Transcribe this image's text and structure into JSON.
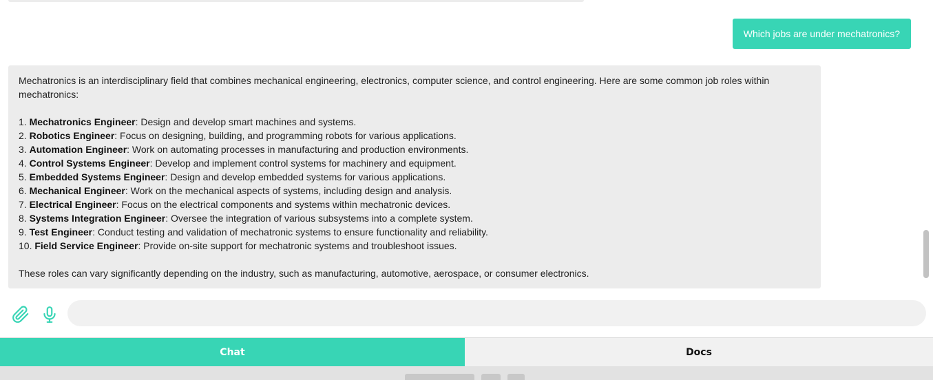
{
  "colors": {
    "accent": "#38d5b5",
    "bubble_bg": "#ececec",
    "input_bg": "#f1f1f1"
  },
  "messages": {
    "user": "Which jobs are under mechatronics?",
    "bot": {
      "intro": "Mechatronics is an interdisciplinary field that combines mechanical engineering, electronics, computer science, and control engineering. Here are some common job roles within mechatronics:",
      "items": [
        {
          "num": "1.",
          "title": "Mechatronics Engineer",
          "desc": ": Design and develop smart machines and systems."
        },
        {
          "num": "2.",
          "title": "Robotics Engineer",
          "desc": ": Focus on designing, building, and programming robots for various applications."
        },
        {
          "num": "3.",
          "title": "Automation Engineer",
          "desc": ": Work on automating processes in manufacturing and production environments."
        },
        {
          "num": "4.",
          "title": "Control Systems Engineer",
          "desc": ": Develop and implement control systems for machinery and equipment."
        },
        {
          "num": "5.",
          "title": "Embedded Systems Engineer",
          "desc": ": Design and develop embedded systems for various applications."
        },
        {
          "num": "6.",
          "title": "Mechanical Engineer",
          "desc": ": Work on the mechanical aspects of systems, including design and analysis."
        },
        {
          "num": "7.",
          "title": "Electrical Engineer",
          "desc": ": Focus on the electrical components and systems within mechatronic devices."
        },
        {
          "num": "8.",
          "title": "Systems Integration Engineer",
          "desc": ": Oversee the integration of various subsystems into a complete system."
        },
        {
          "num": "9.",
          "title": "Test Engineer",
          "desc": ": Conduct testing and validation of mechatronic systems to ensure functionality and reliability."
        },
        {
          "num": "10.",
          "title": "Field Service Engineer",
          "desc": ": Provide on-site support for mechatronic systems and troubleshoot issues."
        }
      ],
      "outro": "These roles can vary significantly depending on the industry, such as manufacturing, automotive, aerospace, or consumer electronics."
    }
  },
  "input": {
    "value": "",
    "attach_icon": "paperclip-icon",
    "mic_icon": "microphone-icon"
  },
  "tabs": {
    "chat": "Chat",
    "docs": "Docs",
    "active": "chat"
  }
}
